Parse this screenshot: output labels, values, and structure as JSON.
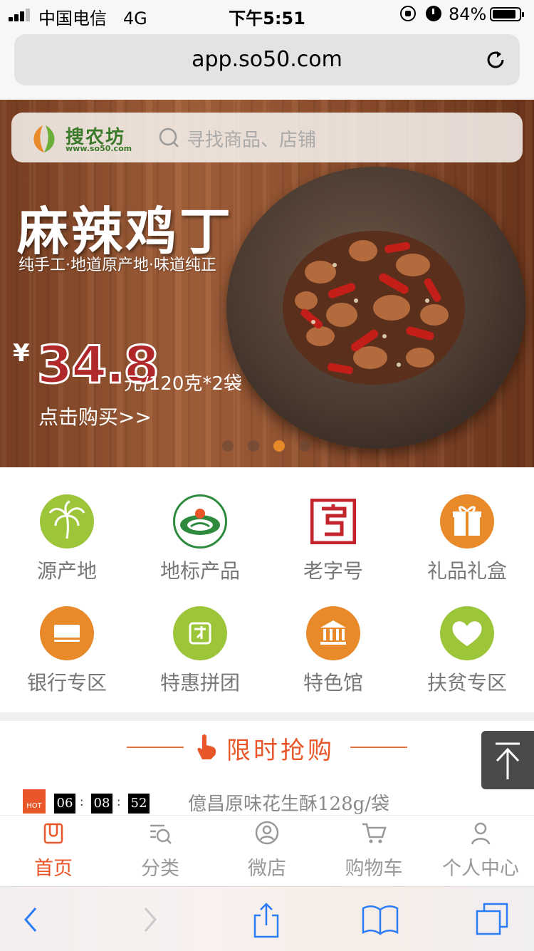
{
  "status_bar": {
    "carrier": "中国电信",
    "network": "4G",
    "time": "下午5:51",
    "battery_pct": "84%"
  },
  "browser": {
    "url": "app.so50.com"
  },
  "search": {
    "brand_name": "搜农坊",
    "brand_url": "www.so50.com",
    "placeholder": "寻找商品、店铺"
  },
  "banner": {
    "title": "麻辣鸡丁",
    "subtitle": "纯手工·地道原产地·味道纯正",
    "currency": "¥",
    "price": "34.8",
    "unit": "元/120克*2袋",
    "cta": "点击购买>>",
    "slide_count": 4,
    "active_slide": 3
  },
  "categories": [
    {
      "label": "源产地",
      "icon": "palm-tree-icon",
      "color": "#9cc53a"
    },
    {
      "label": "地标产品",
      "icon": "geo-mark-seal-icon",
      "color": "#2e8b3e"
    },
    {
      "label": "老字号",
      "icon": "time-honored-brand-icon",
      "color": "#c4242b"
    },
    {
      "label": "礼品礼盒",
      "icon": "gift-icon",
      "color": "#e8892a"
    },
    {
      "label": "银行专区",
      "icon": "bank-card-icon",
      "color": "#e8892a"
    },
    {
      "label": "特惠拼团",
      "icon": "group-buy-icon",
      "color": "#9cc53a"
    },
    {
      "label": "特色馆",
      "icon": "museum-icon",
      "color": "#e8892a"
    },
    {
      "label": "扶贫专区",
      "icon": "heart-icon",
      "color": "#9cc53a"
    }
  ],
  "flash_sale": {
    "title": "限时抢购",
    "hot_label": "HOT",
    "countdown": {
      "h": "06",
      "m": "08",
      "s": "52"
    },
    "product": "億昌原味花生酥128g/袋"
  },
  "tabs": [
    {
      "label": "首页",
      "icon": "home-icon",
      "active": true
    },
    {
      "label": "分类",
      "icon": "category-search-icon",
      "active": false
    },
    {
      "label": "微店",
      "icon": "store-user-icon",
      "active": false
    },
    {
      "label": "购物车",
      "icon": "cart-icon",
      "active": false
    },
    {
      "label": "个人中心",
      "icon": "person-icon",
      "active": false
    }
  ],
  "colors": {
    "accent": "#e8562a",
    "green": "#9cc53a",
    "orange": "#e8892a",
    "safari_blue": "#2b7cf6"
  }
}
